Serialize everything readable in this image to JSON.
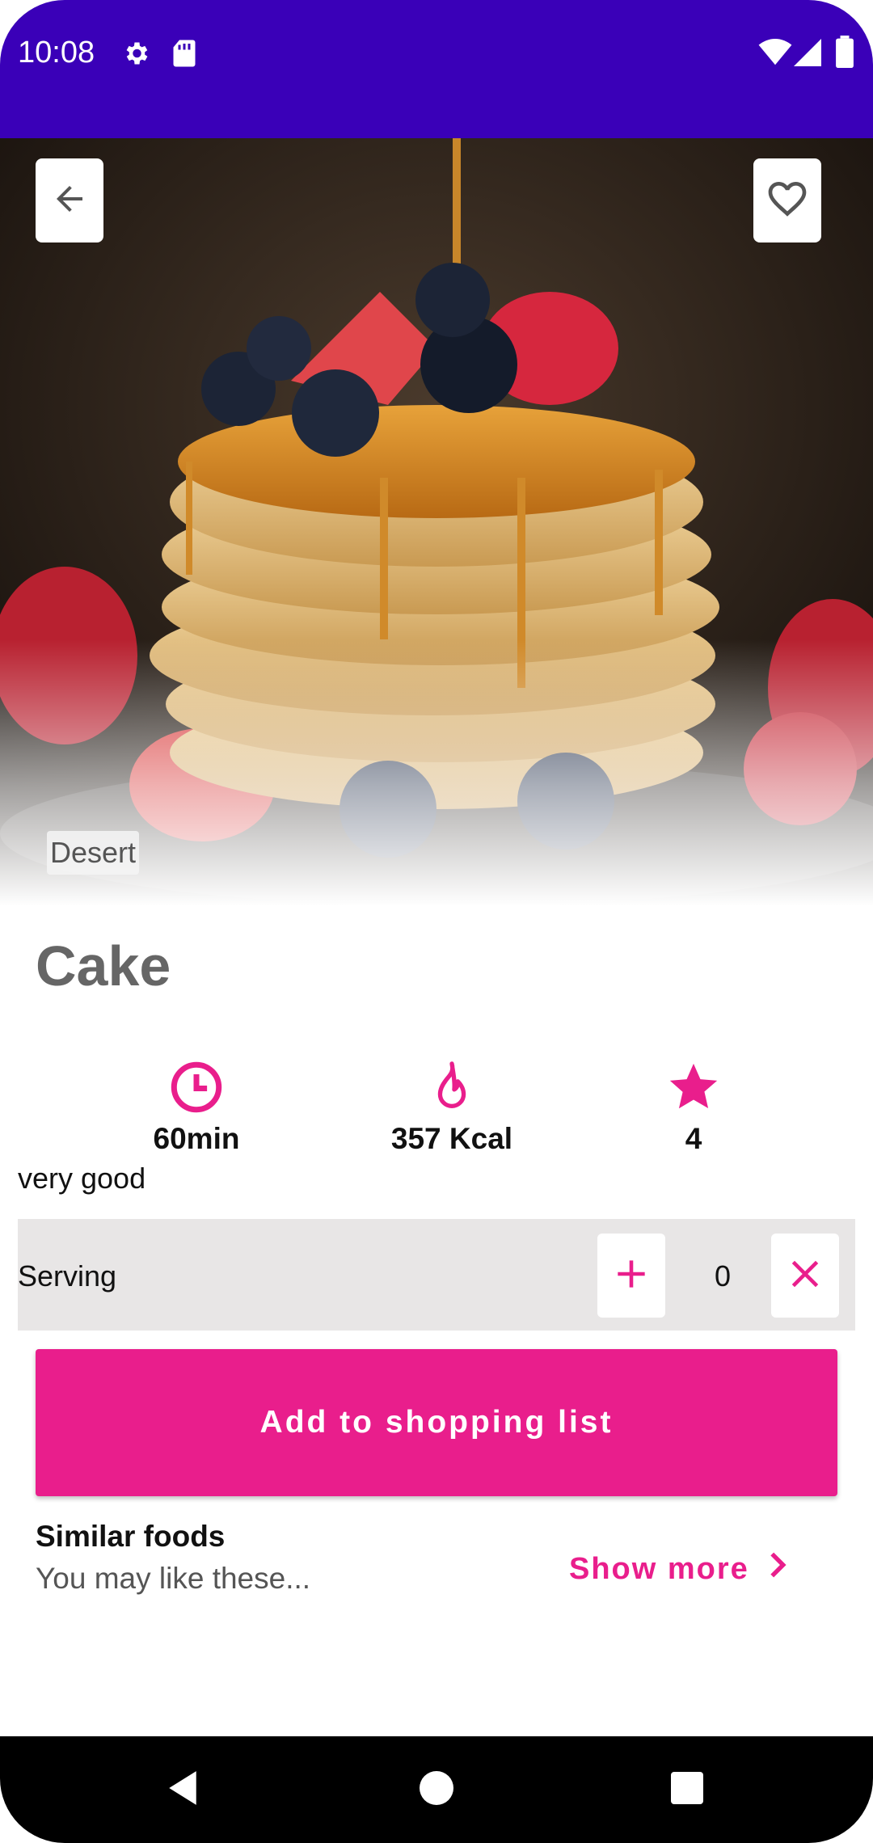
{
  "status_bar": {
    "time": "10:08",
    "icons": [
      "settings-icon",
      "sd-card-icon",
      "wifi-icon",
      "signal-icon",
      "battery-icon"
    ]
  },
  "hero": {
    "image": "pancake-stack-photo",
    "category": "Desert"
  },
  "toolbar": {
    "back_icon": "arrow-left-icon",
    "favorite_icon": "heart-outline-icon"
  },
  "recipe": {
    "title": "Cake",
    "stats": [
      {
        "icon": "clock-icon",
        "label": "60min"
      },
      {
        "icon": "flame-icon",
        "label": "357 Kcal"
      },
      {
        "icon": "star-icon",
        "label": "4"
      }
    ],
    "rating_text": "very good"
  },
  "serving": {
    "label": "Serving",
    "value": "0",
    "increment_icon": "plus-icon",
    "clear_icon": "close-icon"
  },
  "actions": {
    "add_to_list": "Add to shopping list"
  },
  "similar": {
    "title": "Similar foods",
    "subtitle": "You may like these...",
    "show_more": "Show more"
  },
  "colors": {
    "status_bar": "#3a00b8",
    "accent": "#e91e8c",
    "serving_bg": "#e8e6e6",
    "nav_bar": "#000000"
  }
}
